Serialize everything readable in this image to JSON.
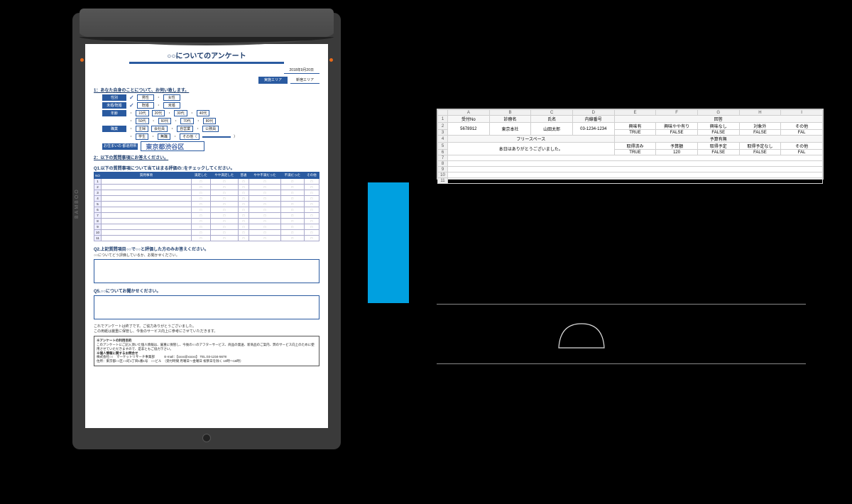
{
  "tablet": {
    "brand": "BAMBOO",
    "form": {
      "title": "○○についてのアンケート",
      "date": "2018年9月20日",
      "area_label": "実施エリア",
      "area_value": "新宿エリア",
      "section1": "1：あなた自身のことについて、お伺い致します。",
      "rows": {
        "gender": {
          "label": "性別",
          "opts": [
            "男性",
            "女性"
          ],
          "mark": "✓"
        },
        "marital": {
          "label": "未婚/既婚",
          "opts": [
            "既婚",
            "未婚"
          ],
          "mark": "✓"
        },
        "age": {
          "label": "年齢",
          "opts": [
            "10代",
            "20代",
            "30代",
            "40代",
            "50代",
            "60代",
            "70代",
            "80代"
          ],
          "mark": "✓"
        },
        "occupation": {
          "label": "職業",
          "opts": [
            "主婦",
            "会社員",
            "自営業",
            "公務員",
            "学生",
            "無職",
            "その他（",
            "）"
          ],
          "mark": "✓"
        },
        "address": {
          "label": "お住まいの\n都道府県",
          "value": "東京都渋谷区"
        }
      },
      "section2": "2：以下の質問事項にお答えください。",
      "q1": {
        "label": "Q1.以下の質問事項について当てはまる評価の□をチェックしてください。",
        "header_no": "NO",
        "header_item": "質問事項",
        "cols": [
          "満足した",
          "やや満足した",
          "普通",
          "やや不満だった",
          "不満だった",
          "その他"
        ],
        "row_count": 11
      },
      "q2": {
        "label": "Q2.上記質問項目○○で○○と評価した方のみお答えください。",
        "sub": "○○についてどう評価しているか、お聞かせください。"
      },
      "q5": {
        "label": "Q5.○○についてお聞かせください。"
      },
      "closing1": "これでアンケートは終了です。ご協力ありがとうございました。",
      "closing2": "この用紙は厳重に保管し、今後のサービス向上に参考にさせていただきます。",
      "footer": {
        "title": "※アンケートの利用目的",
        "line1": "このアンケートにご記入頂いた個人情報は、厳重に保管し、今後の○○のアフターサービス、商品の発送、新商品のご案内、弊のサービス向上のために使用させていただきますので、是非ともご協力下さい。",
        "title2": "※個人情報に関するお問合せ",
        "line2": "株式会社○○　マーケットリサーチ事業部　　　E-mail：【xxxx@xxxxx】 TEL:03-1234-5678",
        "line3": "住所：東京都○○区○○町1丁目1番1号　○○ビル　（受付時間 月曜日〜金曜日 祝祭日を除く 10時〜16時）"
      }
    }
  },
  "spreadsheet": {
    "cols": [
      "A",
      "B",
      "C",
      "D",
      "E",
      "F",
      "G",
      "H",
      "I"
    ],
    "headers": [
      "受付No",
      "診療名",
      "氏名",
      "内線番号",
      "",
      "",
      "",
      "",
      ""
    ],
    "row2": [
      "5678912",
      "東京本社",
      "山田太郎",
      "03-1234-1234",
      "興味有",
      "興味やや有り",
      "興味なし",
      "対象外",
      "その他"
    ],
    "row3": [
      "",
      "",
      "",
      "",
      "TRUE",
      "FALSE",
      "FALSE",
      "FALSE",
      "FAL"
    ],
    "row4_label": "フリースペース",
    "row4_right": "予算有無",
    "row5_text": "本日はありがとうございました。",
    "row5_right": [
      "取得済み",
      "予算額",
      "取得予定",
      "取得予定なし",
      "その他"
    ],
    "row6_right": [
      "TRUE",
      "120",
      "FALSE",
      "FALSE",
      "FAL"
    ]
  },
  "dome": {
    "name": "dome-shape"
  }
}
